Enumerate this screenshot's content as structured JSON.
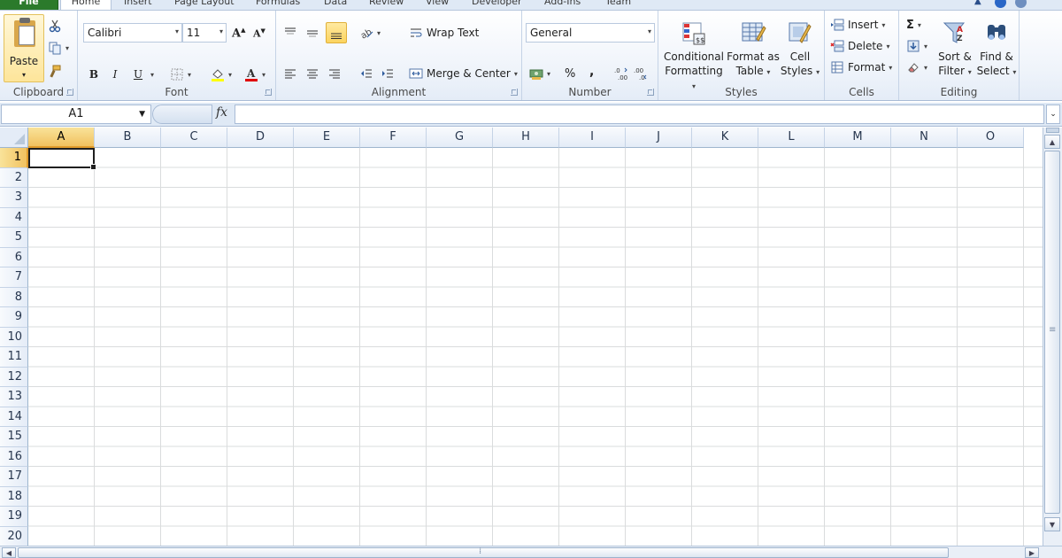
{
  "tabs": {
    "file": "File",
    "items": [
      "Home",
      "Insert",
      "Page Layout",
      "Formulas",
      "Data",
      "Review",
      "View",
      "Developer",
      "Add-Ins",
      "Team"
    ]
  },
  "clipboard": {
    "label": "Clipboard",
    "paste": "Paste"
  },
  "font": {
    "label": "Font",
    "name": "Calibri",
    "size": "11",
    "bold": "B",
    "italic": "I",
    "underline": "U"
  },
  "alignment": {
    "label": "Alignment",
    "wrap_text": "Wrap Text",
    "merge_center": "Merge & Center"
  },
  "number": {
    "label": "Number",
    "format": "General",
    "percent": "%",
    "comma": ","
  },
  "styles": {
    "label": "Styles",
    "conditional_1": "Conditional",
    "conditional_2": "Formatting",
    "format_table_1": "Format as",
    "format_table_2": "Table",
    "cell_styles_1": "Cell",
    "cell_styles_2": "Styles"
  },
  "cells": {
    "label": "Cells",
    "insert": "Insert",
    "delete": "Delete",
    "format": "Format"
  },
  "editing": {
    "label": "Editing",
    "sum": "Σ",
    "sort_1": "Sort &",
    "sort_2": "Filter",
    "find_1": "Find &",
    "find_2": "Select"
  },
  "formula_bar": {
    "name_box": "A1",
    "fx": "fx",
    "content": ""
  },
  "grid": {
    "columns": [
      "A",
      "B",
      "C",
      "D",
      "E",
      "F",
      "G",
      "H",
      "I",
      "J",
      "K",
      "L",
      "M",
      "N",
      "O"
    ],
    "rows": [
      "1",
      "2",
      "3",
      "4",
      "5",
      "6",
      "7",
      "8",
      "9",
      "10",
      "11",
      "12",
      "13",
      "14",
      "15",
      "16",
      "17",
      "18",
      "19",
      "20"
    ],
    "selected_column": "A",
    "selected_row": "1"
  },
  "colors": {
    "file_tab": "#2b7a2b",
    "selection_header": "#f1c15f",
    "gridline": "#dadcdd",
    "font_color_bar": "#e00000",
    "highlight_bar": "#ffff00"
  }
}
